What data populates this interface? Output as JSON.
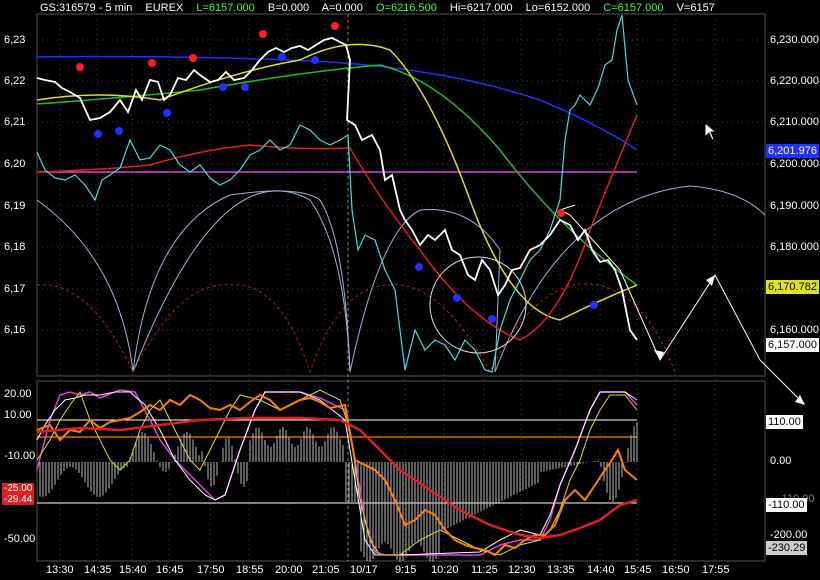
{
  "header": {
    "symbol": "GS:316579 - 5 min",
    "exchange": "EUREX",
    "last": "L=6157.000",
    "bid": "B=0.000",
    "ask": "A=0.000",
    "open": "O=6216.500",
    "high": "Hi=6217.000",
    "low": "Lo=6152.000",
    "close": "C=6157.000",
    "volume": "V=6157"
  },
  "price_axis_right": [
    "6,230.000",
    "6,220.000",
    "6,210.000",
    "6,200.000",
    "6,190.000",
    "6,180.000",
    "6,160.000"
  ],
  "price_axis_left": [
    "6,23",
    "6,22",
    "6,21",
    "6,20",
    "6,19",
    "6,18",
    "6,17",
    "6,16"
  ],
  "price_boxes": {
    "blue_ma": "6,201.976",
    "yellow_level": "6,170.782",
    "last_price": "6,157.000"
  },
  "osc_axis_left": [
    "20.00",
    "10.00",
    "-10.00",
    "-25.00",
    "-29.44",
    "-50.00"
  ],
  "osc_axis_right": [
    "110.00",
    "0.00",
    "-110.00",
    "-200.00",
    "-230.29"
  ],
  "osc_boxes": {
    "red_value_1": "-25.00",
    "red_value_2": "-29.44",
    "upper_line": "110.00",
    "lower_line": "-110.00",
    "last_value": "-230.29"
  },
  "time_axis": [
    "13:30",
    "14:35",
    "15:40",
    "16:45",
    "17:50",
    "18:55",
    "20:00",
    "21:05",
    "10/17",
    "9:15",
    "10:20",
    "11:25",
    "12:30",
    "13:35",
    "14:40",
    "15:45",
    "16:50",
    "17:55"
  ],
  "colors": {
    "background": "#000000",
    "price_line": "#ffffff",
    "cyan_line": "#40e0e0",
    "blue_ma": "#2030ff",
    "green_ma": "#20c020",
    "yellow_ma": "#e0e020",
    "red_ma": "#e02020",
    "magenta_level": "#e040e0",
    "arc_line": "#a0b0e0",
    "orange_line": "#ff8000"
  },
  "chart_data": {
    "type": "line",
    "title": "GS:316579 - 5 min",
    "y_range": [
      6150,
      6235
    ],
    "series": [
      {
        "name": "price",
        "values": [
          6220,
          6221,
          6219,
          6216,
          6215,
          6212,
          6214,
          6213,
          6216,
          6218,
          6217,
          6221,
          6222,
          6220,
          6222,
          6223,
          6226,
          6224,
          6228,
          6226,
          6230,
          6229,
          6212,
          6205,
          6195,
          6183,
          6177,
          6172,
          6178,
          6168,
          6174,
          6169,
          6176,
          6182,
          6187,
          6185,
          6180,
          6174,
          6160,
          6157
        ]
      },
      {
        "values": [
          6203,
          6197,
          6199,
          6196,
          6200,
          6199,
          6205,
          6203,
          6207,
          6199,
          6203,
          6212,
          6210,
          6218,
          6207,
          6187,
          6173,
          6168,
          6166,
          6163,
          6170,
          6160,
          6163,
          6158,
          6165,
          6173,
          6186,
          6190,
          6209,
          6225,
          6222,
          6235,
          6215
        ]
      }
    ]
  }
}
